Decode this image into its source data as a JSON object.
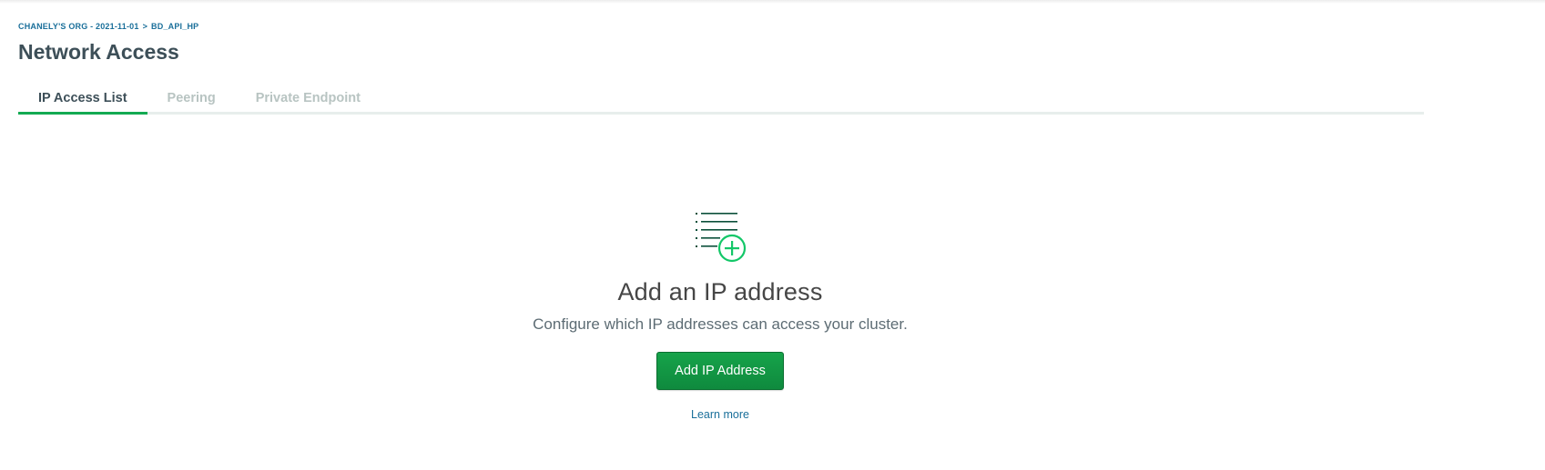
{
  "breadcrumb": {
    "org": "CHANELY'S ORG - 2021-11-01",
    "separator": ">",
    "project": "BD_API_HP"
  },
  "header": {
    "title": "Network Access"
  },
  "tabs": [
    {
      "label": "IP Access List",
      "active": true
    },
    {
      "label": "Peering",
      "active": false
    },
    {
      "label": "Private Endpoint",
      "active": false
    }
  ],
  "empty_state": {
    "icon": "list-add-icon",
    "title": "Add an IP address",
    "description": "Configure which IP addresses can access your cluster.",
    "button_label": "Add IP Address",
    "link_label": "Learn more"
  },
  "colors": {
    "accent_green": "#13aa52",
    "button_green": "#16a34a",
    "link_blue": "#1a6f9a",
    "icon_dark_green": "#0b4f3a",
    "icon_plus_green": "#13c768"
  }
}
